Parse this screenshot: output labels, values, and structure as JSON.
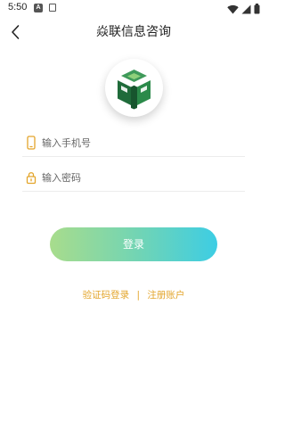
{
  "status_bar": {
    "time": "5:50",
    "badge": "A"
  },
  "header": {
    "title": "焱联信息咨询"
  },
  "form": {
    "phone_placeholder": "输入手机号",
    "password_placeholder": "输入密码"
  },
  "login_button": "登录",
  "links": {
    "code_login": "验证码登录",
    "separator": "|",
    "register": "注册账户"
  },
  "colors": {
    "accent": "#e3a52b",
    "button_gradient_start": "#a8dc8c",
    "button_gradient_end": "#3dcde4",
    "logo_green": "#1f6b3a"
  }
}
